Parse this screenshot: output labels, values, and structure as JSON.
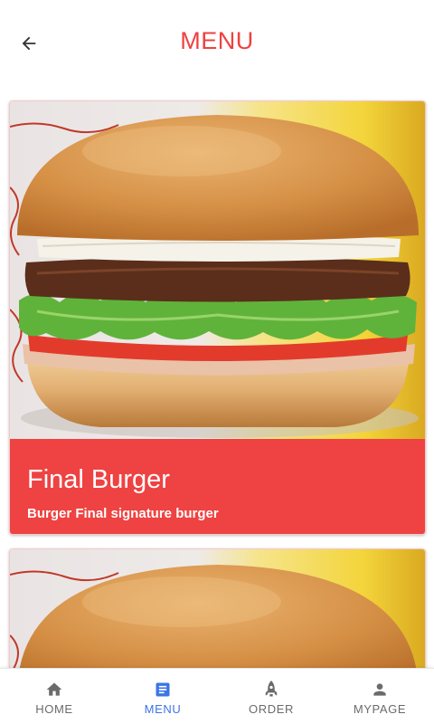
{
  "header": {
    "title": "MENU",
    "back_icon": "arrow-left-icon"
  },
  "menu_items": [
    {
      "name": "Final Burger",
      "description": "Burger Final signature burger",
      "image": "burger-photo"
    },
    {
      "image": "burger-photo"
    }
  ],
  "bottom_nav": [
    {
      "label": "HOME",
      "icon": "home-icon",
      "active": false
    },
    {
      "label": "MENU",
      "icon": "document-icon",
      "active": true
    },
    {
      "label": "ORDER",
      "icon": "rocket-icon",
      "active": false
    },
    {
      "label": "MYPAGE",
      "icon": "person-icon",
      "active": false
    }
  ],
  "colors": {
    "accent": "#ef4242",
    "title": "#f04040",
    "nav_active": "#3d74e6",
    "nav_inactive": "#6b6b6b"
  }
}
